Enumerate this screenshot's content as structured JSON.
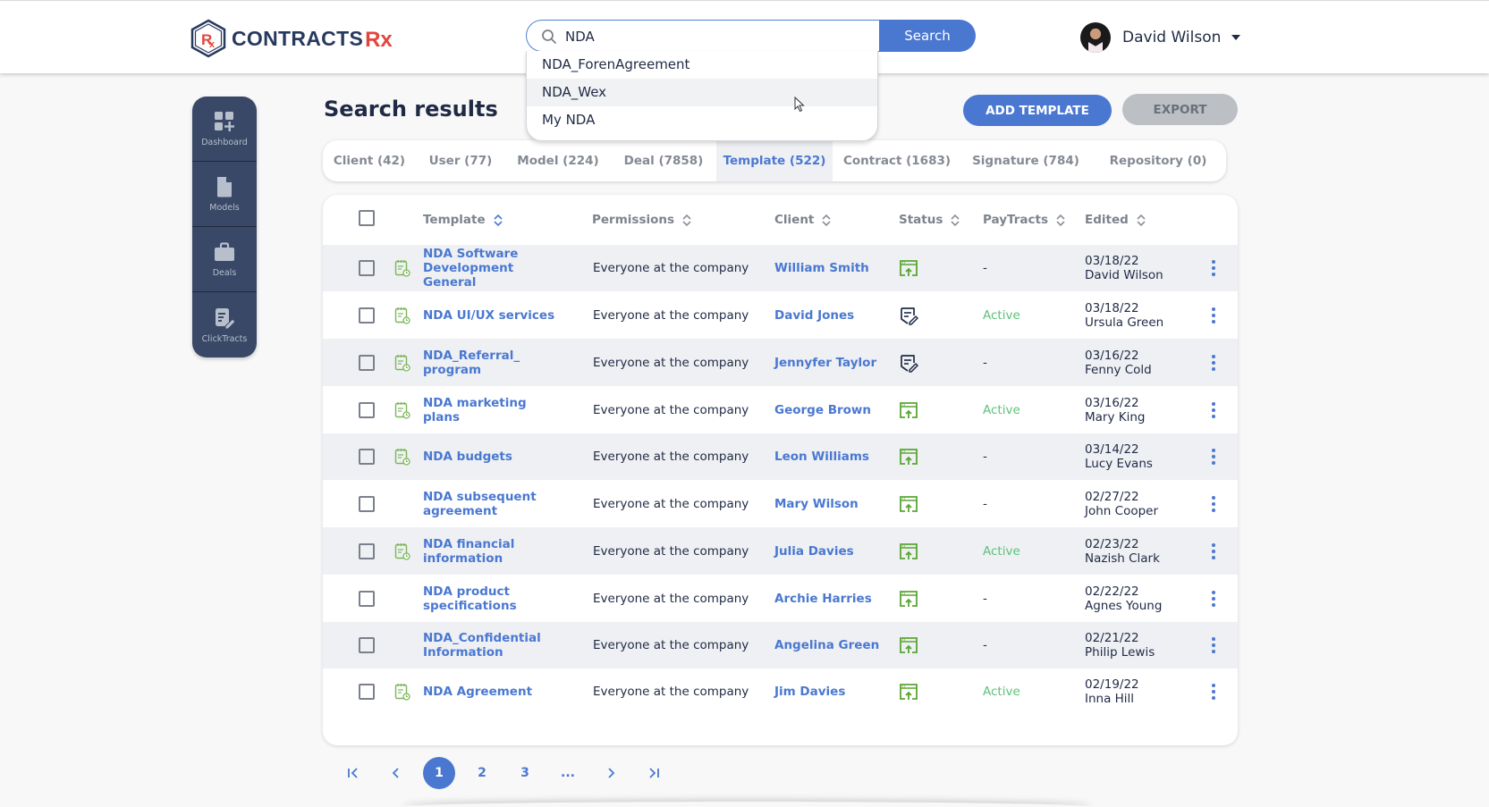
{
  "header": {
    "logo_text": "CONTRACTS",
    "logo_rx": "Rx",
    "search": {
      "value": "NDA",
      "placeholder": "",
      "button_label": "Search"
    },
    "suggestions": [
      "NDA_ForenAgreement",
      "NDA_Wex",
      "My NDA"
    ],
    "user": {
      "name": "David Wilson"
    }
  },
  "sidebar": {
    "items": [
      {
        "label": "Dashboard",
        "icon": "dashboard-add-icon"
      },
      {
        "label": "Models",
        "icon": "document-icon"
      },
      {
        "label": "Deals",
        "icon": "briefcase-icon"
      },
      {
        "label": "ClickTracts",
        "icon": "document-edit-icon"
      }
    ]
  },
  "main": {
    "title": "Search results",
    "add_button": "ADD TEMPLATE",
    "export_button": "EXPORT",
    "tabs": [
      {
        "label": "Client (42)",
        "active": false
      },
      {
        "label": "User (77)",
        "active": false
      },
      {
        "label": "Model (224)",
        "active": false
      },
      {
        "label": "Deal (7858)",
        "active": false
      },
      {
        "label": "Template (522)",
        "active": true
      },
      {
        "label": "Contract (1683)",
        "active": false
      },
      {
        "label": "Signature (784)",
        "active": false
      },
      {
        "label": "Repository (0)",
        "active": false
      }
    ],
    "columns": [
      "Template",
      "Permissions",
      "Client",
      "Status",
      "PayTracts",
      "Edited"
    ],
    "rows": [
      {
        "template": "NDA Software Development General",
        "has_icon": true,
        "permissions": "Everyone at the company",
        "client": "William Smith",
        "status": "published",
        "paytracts": "-",
        "date": "03/18/22",
        "editor": "David Wilson"
      },
      {
        "template": "NDA UI/UX services",
        "has_icon": true,
        "permissions": "Everyone at the company",
        "client": "David Jones",
        "status": "draft",
        "paytracts": "Active",
        "date": "03/18/22",
        "editor": "Ursula Green"
      },
      {
        "template": "NDA_Referral_ program",
        "has_icon": true,
        "permissions": "Everyone at the company",
        "client": "Jennyfer Taylor",
        "status": "draft",
        "paytracts": "-",
        "date": "03/16/22",
        "editor": "Fenny Cold"
      },
      {
        "template": "NDA marketing plans",
        "has_icon": true,
        "permissions": "Everyone at the company",
        "client": "George Brown",
        "status": "published",
        "paytracts": "Active",
        "date": "03/16/22",
        "editor": "Mary King"
      },
      {
        "template": "NDA budgets",
        "has_icon": true,
        "permissions": "Everyone at the company",
        "client": "Leon Williams",
        "status": "published",
        "paytracts": "-",
        "date": "03/14/22",
        "editor": "Lucy Evans"
      },
      {
        "template": "NDA subsequent agreement",
        "has_icon": false,
        "permissions": "Everyone at the company",
        "client": "Mary Wilson",
        "status": "published",
        "paytracts": "-",
        "date": "02/27/22",
        "editor": "John Cooper"
      },
      {
        "template": "NDA financial information",
        "has_icon": true,
        "permissions": "Everyone at the company",
        "client": "Julia Davies",
        "status": "published",
        "paytracts": "Active",
        "date": "02/23/22",
        "editor": "Nazish Clark"
      },
      {
        "template": "NDA product specifications",
        "has_icon": false,
        "permissions": "Everyone at the company",
        "client": "Archie Harries",
        "status": "published",
        "paytracts": "-",
        "date": "02/22/22",
        "editor": "Agnes Young"
      },
      {
        "template": "NDA_Confidential Information",
        "has_icon": false,
        "permissions": "Everyone at the company",
        "client": "Angelina Green",
        "status": "published",
        "paytracts": "-",
        "date": "02/21/22",
        "editor": "Philip Lewis"
      },
      {
        "template": "NDA Agreement",
        "has_icon": true,
        "permissions": "Everyone at the company",
        "client": "Jim Davies",
        "status": "published",
        "paytracts": "Active",
        "date": "02/19/22",
        "editor": "Inna Hill"
      }
    ],
    "pagination": {
      "pages": [
        "1",
        "2",
        "3",
        "..."
      ],
      "current": "1"
    }
  },
  "colors": {
    "accent": "#4a78d1",
    "sidebar": "#384866",
    "active_green": "#5cc27a",
    "status_green": "#5aa532",
    "logo_red": "#e2453e",
    "logo_navy": "#27395e"
  }
}
